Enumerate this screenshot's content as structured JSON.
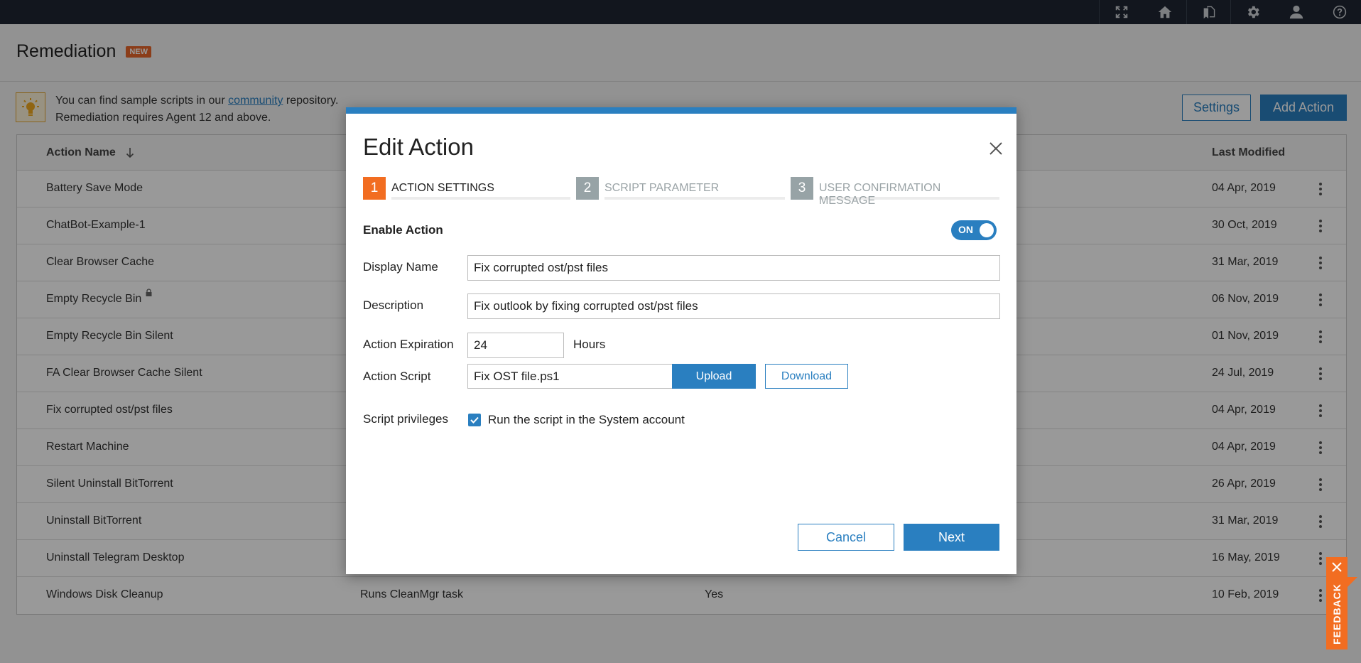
{
  "topbar": {
    "icons": [
      "expand-icon",
      "home-icon",
      "documents-icon",
      "gear-icon",
      "user-icon",
      "help-icon"
    ]
  },
  "page": {
    "title": "Remediation",
    "badge": "NEW",
    "tip": {
      "line1_prefix": "You can find sample scripts in our ",
      "link": "community",
      "line1_suffix": " repository.",
      "line2": "Remediation requires Agent 12 and above."
    },
    "settings_label": "Settings",
    "add_action_label": "Add Action"
  },
  "table": {
    "columns": {
      "name": "Action Name",
      "last_modified": "Last Modified"
    },
    "sort": "descending",
    "rows": [
      {
        "name": "Battery Save Mode",
        "description": "",
        "enabled": "",
        "last_modified": "04 Apr, 2019",
        "locked": false
      },
      {
        "name": "ChatBot-Example-1",
        "description": "",
        "enabled": "",
        "last_modified": "30 Oct, 2019",
        "locked": false
      },
      {
        "name": "Clear Browser Cache",
        "description": "",
        "enabled": "",
        "last_modified": "31 Mar, 2019",
        "locked": false
      },
      {
        "name": "Empty Recycle Bin",
        "description": "",
        "enabled": "",
        "last_modified": "06 Nov, 2019",
        "locked": true
      },
      {
        "name": "Empty Recycle Bin Silent",
        "description": "",
        "enabled": "",
        "last_modified": "01 Nov, 2019",
        "locked": false
      },
      {
        "name": "FA Clear Browser Cache Silent",
        "description": "",
        "enabled": "",
        "last_modified": "24 Jul, 2019",
        "locked": false
      },
      {
        "name": "Fix corrupted ost/pst files",
        "description": "",
        "enabled": "",
        "last_modified": "04 Apr, 2019",
        "locked": false
      },
      {
        "name": "Restart Machine",
        "description": "",
        "enabled": "",
        "last_modified": "04 Apr, 2019",
        "locked": false
      },
      {
        "name": "Silent Uninstall BitTorrent",
        "description": "",
        "enabled": "",
        "last_modified": "26 Apr, 2019",
        "locked": false
      },
      {
        "name": "Uninstall BitTorrent",
        "description": "",
        "enabled": "",
        "last_modified": "31 Mar, 2019",
        "locked": false
      },
      {
        "name": "Uninstall Telegram Desktop",
        "description": "",
        "enabled": "",
        "last_modified": "16 May, 2019",
        "locked": false
      },
      {
        "name": "Windows Disk Cleanup",
        "description": "Runs CleanMgr task",
        "enabled": "Yes",
        "last_modified": "10 Feb, 2019",
        "locked": false
      }
    ]
  },
  "modal": {
    "title": "Edit Action",
    "steps": [
      {
        "number": "1",
        "label": "ACTION SETTINGS",
        "active": true
      },
      {
        "number": "2",
        "label": "SCRIPT PARAMETER",
        "active": false
      },
      {
        "number": "3",
        "label": "USER CONFIRMATION MESSAGE",
        "active": false
      }
    ],
    "enable_label": "Enable Action",
    "enable_toggle": "ON",
    "display_name_label": "Display Name",
    "display_name_value": "Fix corrupted ost/pst files",
    "description_label": "Description",
    "description_value": "Fix outlook by fixing corrupted ost/pst files",
    "expiration_label": "Action Expiration",
    "expiration_value": "24",
    "expiration_unit": "Hours",
    "script_label": "Action Script",
    "script_value": "Fix OST file.ps1",
    "upload_label": "Upload",
    "download_label": "Download",
    "privileges_label": "Script privileges",
    "privileges_checkbox_label": "Run the script in the System account",
    "privileges_checked": true,
    "cancel_label": "Cancel",
    "next_label": "Next"
  },
  "feedback": {
    "label": "FEEDBACK"
  },
  "colors": {
    "accent": "#2a7fc0",
    "orange": "#f26d21",
    "topbar": "#1e2632"
  }
}
